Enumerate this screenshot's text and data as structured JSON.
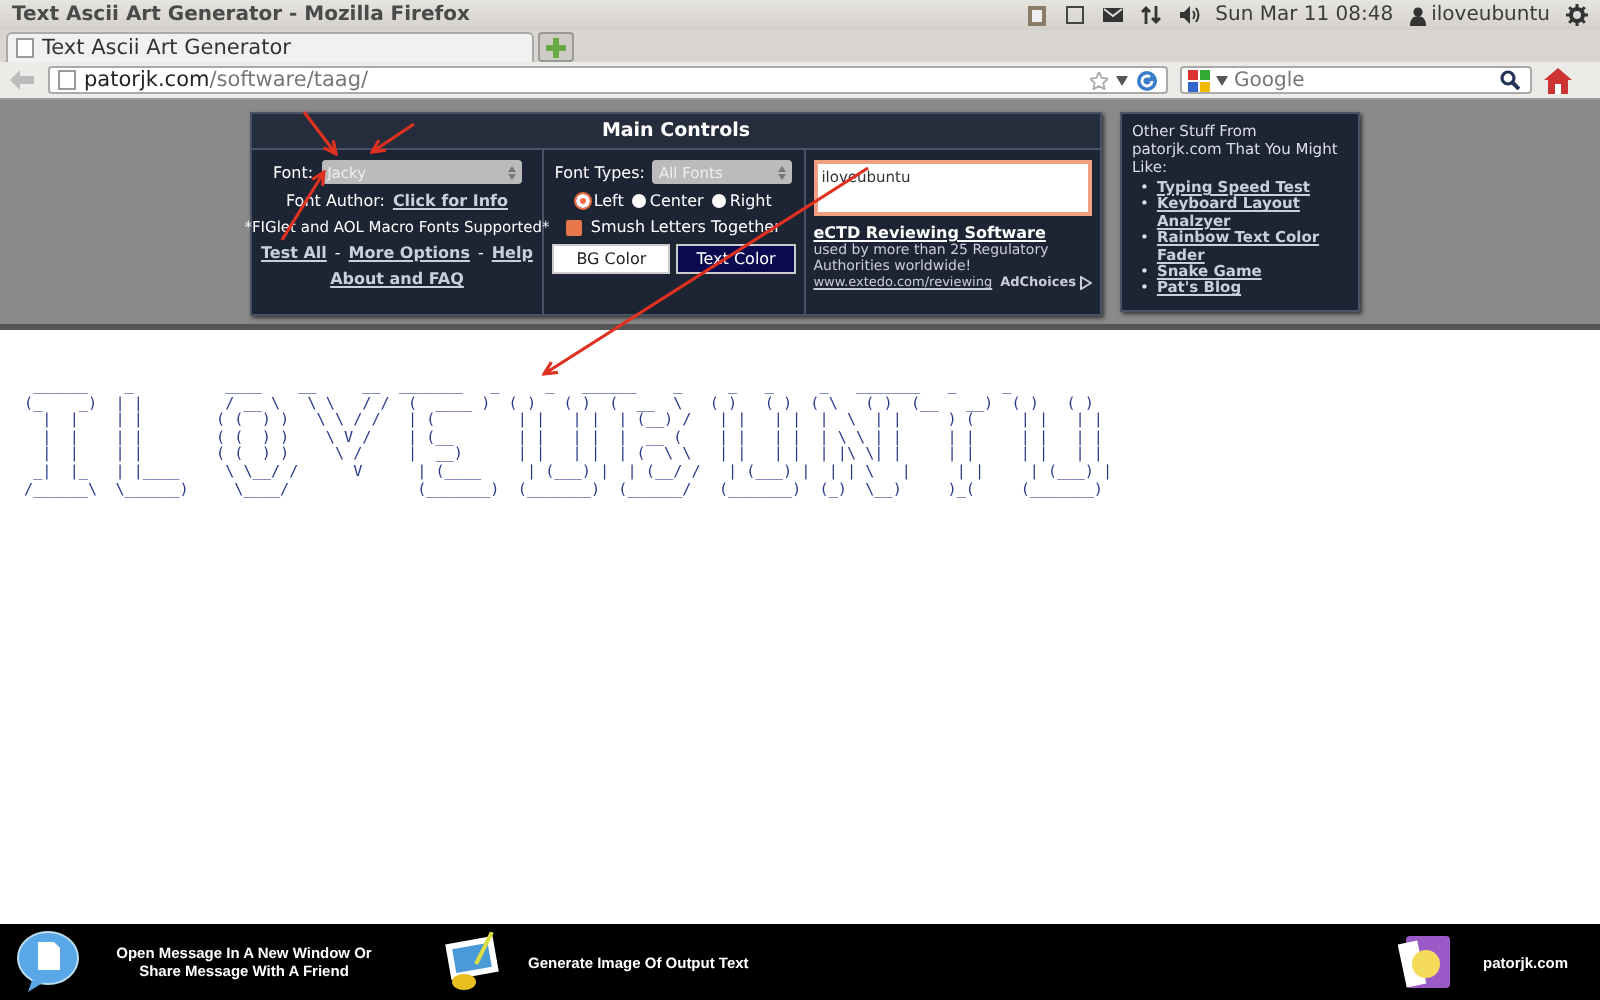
{
  "desktop_bar": {
    "window_title": "Text Ascii Art Generator - Mozilla Firefox",
    "clock": "Sun Mar 11 08:48",
    "user": "iloveubuntu"
  },
  "browser": {
    "tab": "Text Ascii Art Generator",
    "url_host": "patorjk.com",
    "url_path": "/software/taag/",
    "search_placeholder": "Google"
  },
  "main_controls": {
    "title": "Main Controls",
    "font_label": "Font:",
    "font_value": "Jacky",
    "author_label": "Font Author:",
    "author_link": "Click for Info",
    "figlet_note": "*FIGlet and AOL Macro Fonts Supported*",
    "links": [
      "Test All",
      "More Options",
      "Help"
    ],
    "separator": "-",
    "about_link": "About and FAQ",
    "font_types_label": "Font Types:",
    "font_types_value": "All Fonts",
    "alignment": [
      {
        "label": "Left",
        "selected": true
      },
      {
        "label": "Center",
        "selected": false
      },
      {
        "label": "Right",
        "selected": false
      }
    ],
    "smush": {
      "label": "Smush Letters Together",
      "checked": true
    },
    "bg_color_button": "BG Color",
    "text_color_button": "Text Color",
    "input_text": "iloveubuntu",
    "ad": {
      "title": "eCTD Reviewing Software",
      "body": "used by more than 25 Regulatory Authorities worldwide!",
      "url": "www.extedo.com/reviewing",
      "choices": "AdChoices"
    }
  },
  "other_stuff": {
    "heading": "Other Stuff From patorjk.com That You Might Like:",
    "bullet": "•",
    "links": [
      "Typing Speed Test",
      "Keyboard Layout Analzyer",
      "Rainbow Text Color Fader",
      "Snake Game",
      "Pat's Blog"
    ]
  },
  "ascii_art": {
    "lines": [
      " ______    _          ____    __     __  _______   _     _   ______    _     _   _     _   _______   _     _ ",
      "(_    _)  | |         / __ \\   \\ \\   / /  (  ____ )  ( )   ( )  (  __  \\   ( )   ( )  ( \\   ( )  (__   __)  ( )   ( )",
      "  |  |    | |        ( (  ) )   \\ \\ / /   | (         | |   | |  | (__) /   | |   | |  |  \\  | |     ) (     | |   | |",
      "  |  |    | |        ( (  ) )    \\ V /    | (__       | |   | |  |  __ (    | |   | |  | \\ \\ | |     | |     | |   | |",
      "  |  |    | |        ( (  ) )     \\ /     |  __)      | |   | |  | (  \\ \\   | |   | |  | |\\ \\| |     | |     | |   | |",
      " _|  |_   | |____     \\ \\__/ /      V      | (____     | (___) |  | (__/ /   | (___) |  | | \\   |     | |     | (___) |",
      "/______\\  \\______)     \\____/              (_______)  (_______)  (______/   (_______)  (_)  \\__)     )_(     (_______)"
    ]
  },
  "footer": {
    "items": [
      "Open Message In A New Window Or Share Message With A Friend",
      "Generate Image Of Output Text"
    ],
    "brand": "patorjk.com"
  }
}
